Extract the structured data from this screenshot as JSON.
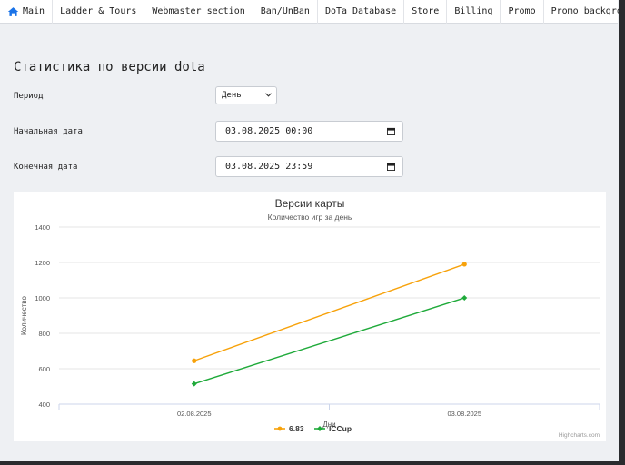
{
  "nav": {
    "items": [
      {
        "label": "Main",
        "icon": "home-icon"
      },
      {
        "label": "Ladder & Tours"
      },
      {
        "label": "Webmaster section"
      },
      {
        "label": "Ban/UnBan"
      },
      {
        "label": "DoTa Database"
      },
      {
        "label": "Store"
      },
      {
        "label": "Billing"
      },
      {
        "label": "Promo"
      },
      {
        "label": "Promo background"
      }
    ]
  },
  "page": {
    "title": "Статистика по версии dota"
  },
  "form": {
    "period_label": "Период",
    "period_value": "День",
    "start_label": "Начальная дата",
    "start_value": "03.08.2025 00:00",
    "end_label": "Конечная дата",
    "end_value": "03.08.2025 23:59"
  },
  "colors": {
    "accent": "#1a73e8",
    "series_683": "#f7a20b",
    "series_iccup": "#1faa3a"
  },
  "chart_data": {
    "type": "line",
    "title": "Версии карты",
    "subtitle": "Количество игр за день",
    "xlabel": "Дни",
    "ylabel": "Количество",
    "categories": [
      "02.08.2025",
      "03.08.2025"
    ],
    "ylim": [
      400,
      1400
    ],
    "yticks": [
      400,
      600,
      800,
      1000,
      1200,
      1400
    ],
    "grid": true,
    "legend": "bottom-center",
    "credit": "Highcharts.com",
    "series": [
      {
        "name": "6.83",
        "values": [
          645,
          1190
        ],
        "color": "#f7a20b"
      },
      {
        "name": "ICCup",
        "values": [
          515,
          1000
        ],
        "color": "#1faa3a"
      }
    ]
  }
}
